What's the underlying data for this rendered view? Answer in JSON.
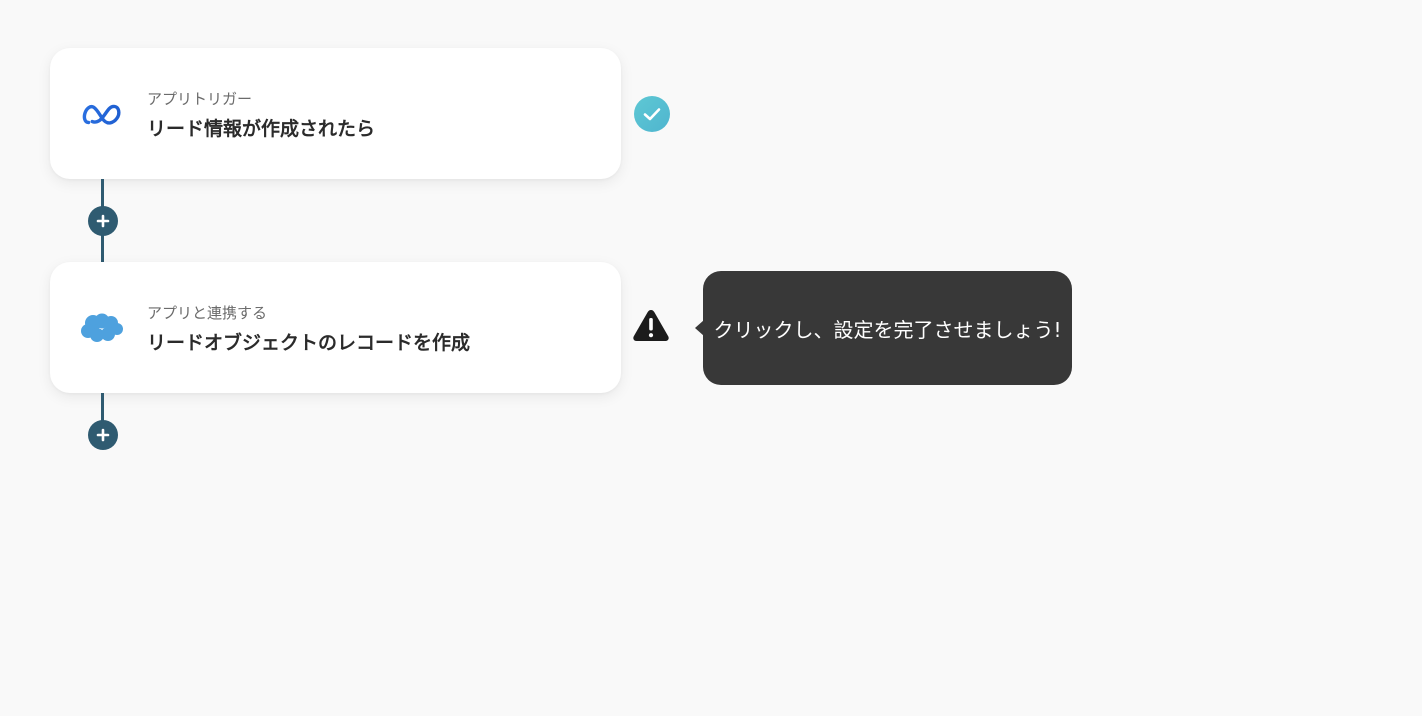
{
  "steps": [
    {
      "type_label": "アプリトリガー",
      "title": "リード情報が作成されたら",
      "app_icon": "meta-logo-icon",
      "status": "complete",
      "status_icon": "check-circle-icon"
    },
    {
      "type_label": "アプリと連携する",
      "title": "リードオブジェクトのレコードを作成",
      "app_icon": "salesforce-cloud-icon",
      "status": "incomplete",
      "status_icon": "warning-icon"
    }
  ],
  "add_step_icon": "plus-icon",
  "tooltip": {
    "text": "クリックし、設定を完了させましょう!"
  },
  "colors": {
    "background": "#f9f9f9",
    "connector": "#2f5b71",
    "check": "#5ec8d4",
    "tooltip_bg": "#383838",
    "meta_blue": "#1877f2",
    "salesforce_blue": "#4ea1de"
  }
}
